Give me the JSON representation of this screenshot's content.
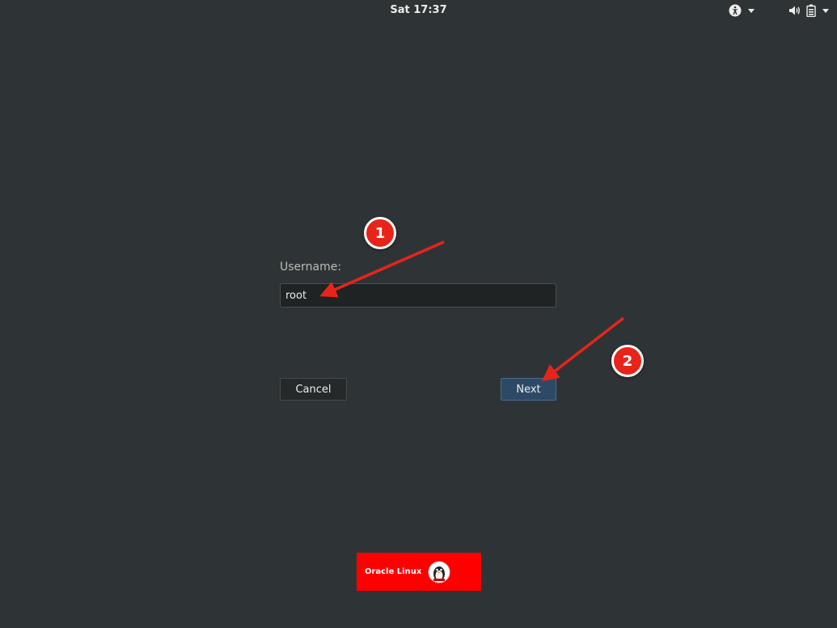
{
  "topbar": {
    "clock": "Sat 17:37",
    "icons": {
      "accessibility": "accessibility-icon",
      "volume": "volume-icon",
      "battery": "battery-icon",
      "menu": "chevron-down-icon"
    }
  },
  "login": {
    "username_label": "Username:",
    "username_value": "root",
    "cancel_label": "Cancel",
    "next_label": "Next"
  },
  "brand": {
    "text": "Oracle Linux",
    "mascot_icon": "penguin-mascot-icon"
  },
  "annotations": {
    "step1": "1",
    "step2": "2"
  },
  "colors": {
    "background": "#2e3436",
    "next_button": "#2c4a66",
    "annotation_red": "#e8241a",
    "brand_red": "#ff0000"
  }
}
